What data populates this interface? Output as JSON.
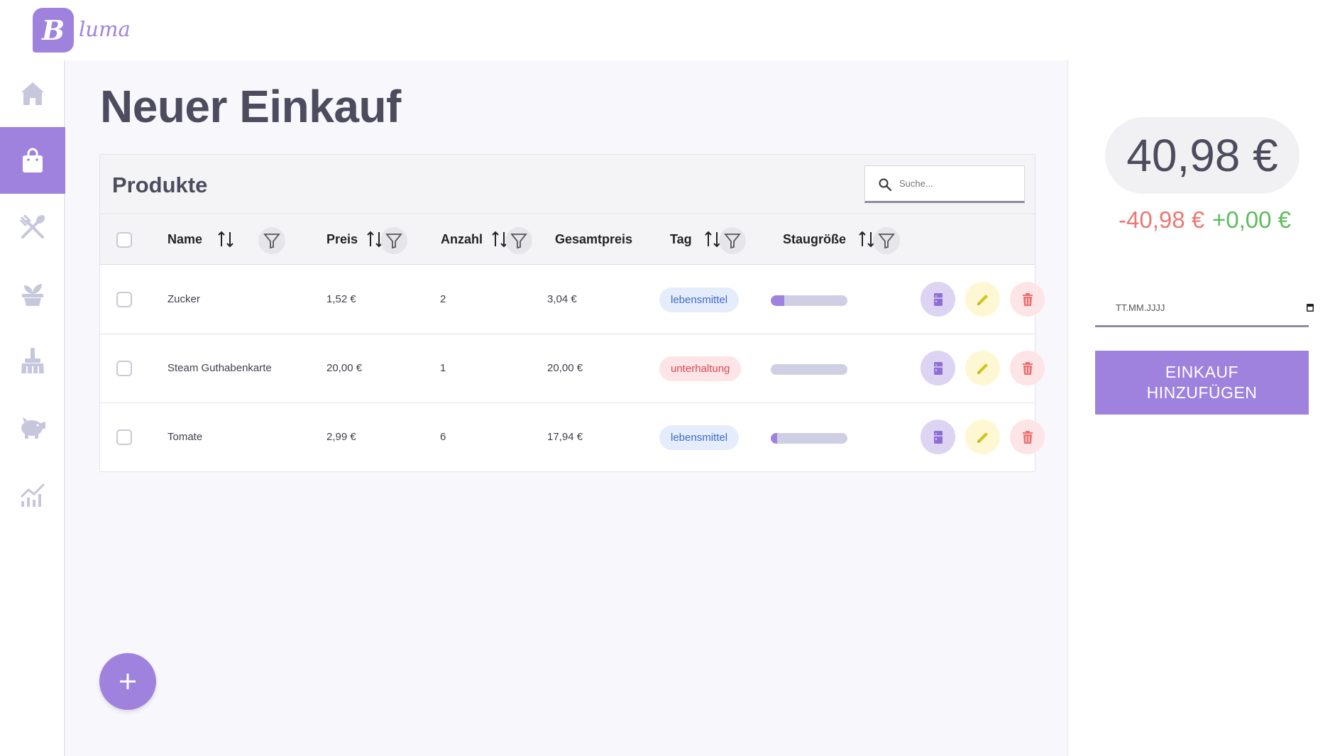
{
  "app": {
    "logo_letter": "B",
    "logo_text": "luma"
  },
  "sidebar": {
    "items": [
      {
        "icon": "home-icon",
        "active": false
      },
      {
        "icon": "shopping-bag-icon",
        "active": true
      },
      {
        "icon": "cutlery-icon",
        "active": false
      },
      {
        "icon": "plant-icon",
        "active": false
      },
      {
        "icon": "broom-icon",
        "active": false
      },
      {
        "icon": "piggy-bank-icon",
        "active": false
      },
      {
        "icon": "chart-icon",
        "active": false
      }
    ]
  },
  "page": {
    "title": "Neuer Einkauf"
  },
  "products": {
    "title": "Produkte",
    "search_placeholder": "Suche...",
    "columns": [
      "Name",
      "Preis",
      "Anzahl",
      "Gesamtpreis",
      "Tag",
      "Staugröße"
    ],
    "rows": [
      {
        "name": "Zucker",
        "price": "1,52 €",
        "qty": "2",
        "total": "3,04 €",
        "tag": "lebensmittel",
        "tag_type": "food",
        "storage_fill": 0.18
      },
      {
        "name": "Steam Guthabenkarte",
        "price": "20,00 €",
        "qty": "1",
        "total": "20,00 €",
        "tag": "unterhaltung",
        "tag_type": "fun",
        "storage_fill": 0
      },
      {
        "name": "Tomate",
        "price": "2,99 €",
        "qty": "6",
        "total": "17,94 €",
        "tag": "lebensmittel",
        "tag_type": "food",
        "storage_fill": 0.08
      }
    ]
  },
  "summary": {
    "total": "40,98 €",
    "negative": "-40,98 €",
    "positive": "+0,00 €",
    "date_placeholder": "TT.MM.JJJJ",
    "add_button": "EINKAUF\nHINZUFÜGEN"
  },
  "colors": {
    "accent": "#9f82dd",
    "negative": "#ea7873",
    "positive": "#5cbd5c"
  }
}
